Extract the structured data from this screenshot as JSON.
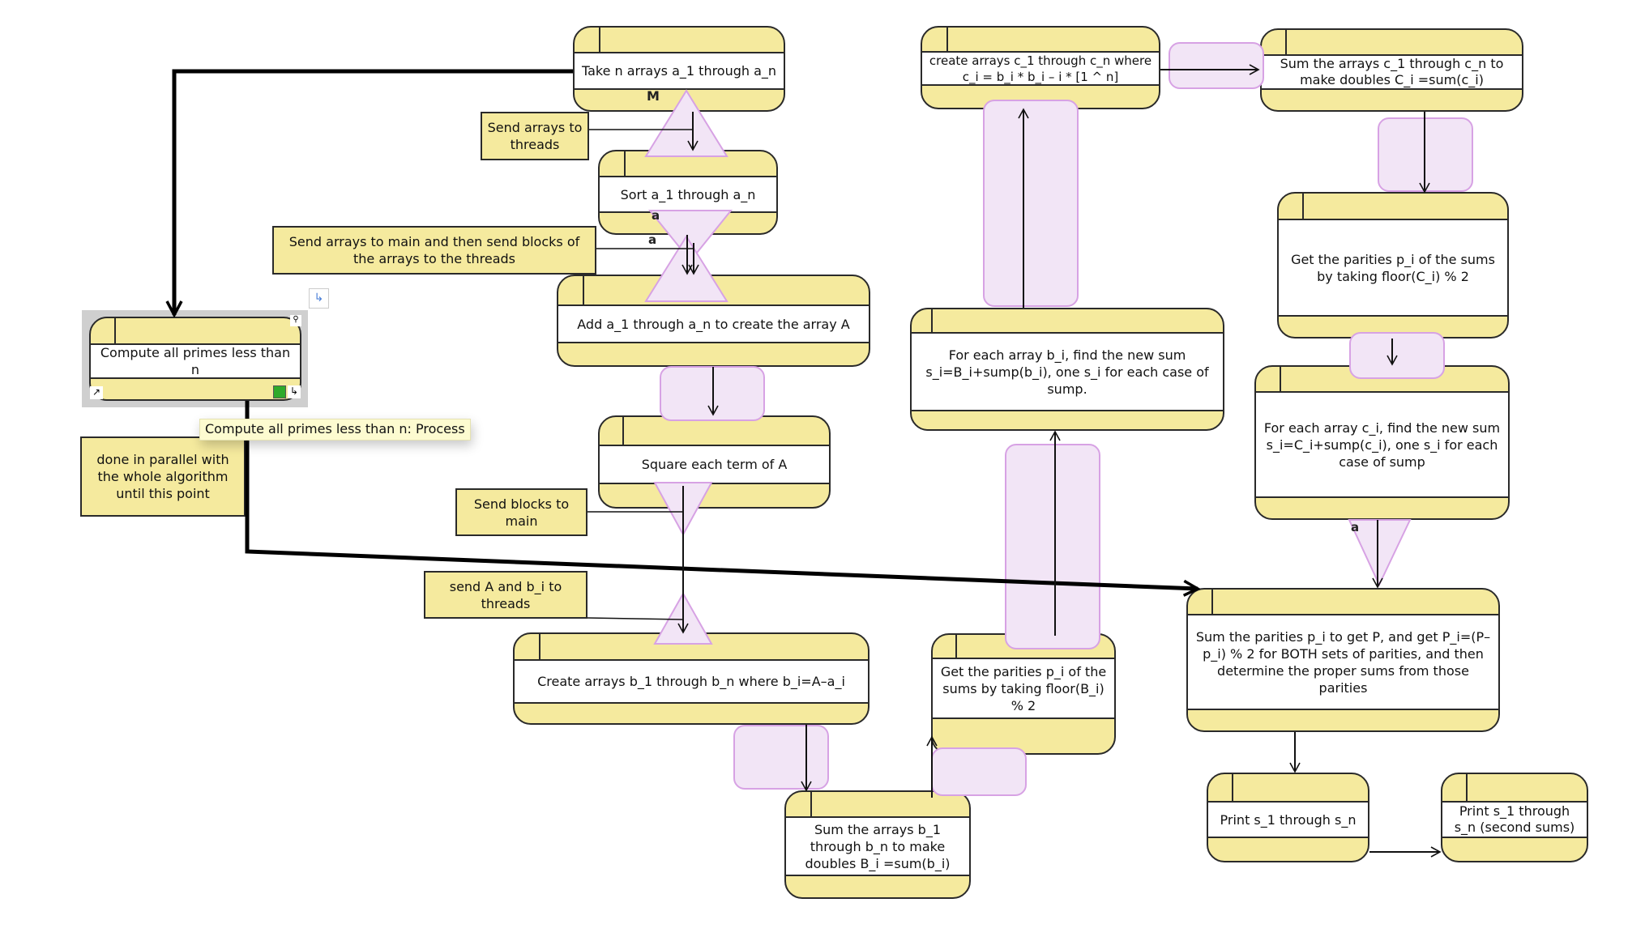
{
  "diagram": {
    "states": {
      "take_arrays": "Take n arrays a_1 through a_n",
      "sort_arrays": "Sort a_1 through a_n",
      "add_arrays": "Add a_1 through a_n to create the array A",
      "square_terms": "Square each term of A",
      "create_b": "Create arrays b_1 through b_n where b_i=A–a_i",
      "sum_b": "Sum the arrays b_1 through b_n to make doubles B_i =sum(b_i)",
      "parities_b": "Get the parities p_i of the sums by taking floor(B_i) % 2",
      "for_each_b": "For each array b_i, find the new sum s_i=B_i+sump(b_i), one s_i for each case of sump.",
      "create_c": "create arrays c_1 through c_n where c_i = b_i * b_i –  i * [1 ^ n]",
      "sum_c": "Sum the arrays c_1 through c_n to make doubles C_i =sum(c_i)",
      "parities_c": "Get the parities p_i of the sums by taking floor(C_i) % 2",
      "for_each_c": "For each array c_i, find the new sum s_i=C_i+sump(c_i), one s_i for each case of sump",
      "sum_parities": "Sum the parities p_i to get P, and get P_i=(P–p_i) % 2 for BOTH sets of parities, and then determine the proper sums from those parities",
      "print_sums": "Print s_1 through s_n",
      "print_second_sums": "Print s_1 through s_n (second sums)",
      "compute_primes": "Compute all primes less than n"
    },
    "notes": {
      "send_to_threads": "Send arrays to threads",
      "send_to_main_blocks": "Send arrays to main and then send blocks of the arrays to the threads",
      "send_blocks_main": "Send blocks to main",
      "send_A_b": "send A and b_i to threads",
      "parallel": "done in parallel with the whole algorithm until this point"
    },
    "labels": {
      "fork_label": "M",
      "join_label_1": "a",
      "join_label_2": "a",
      "join_label_3": "a"
    },
    "tooltip": "Compute all primes less than n: Process",
    "icons": {
      "zoom": "magnifier-icon",
      "shortcut": "shortcut-arrow-icon",
      "expand": "expand-icon",
      "link": "link-icon",
      "connector": "connector-icon"
    }
  }
}
